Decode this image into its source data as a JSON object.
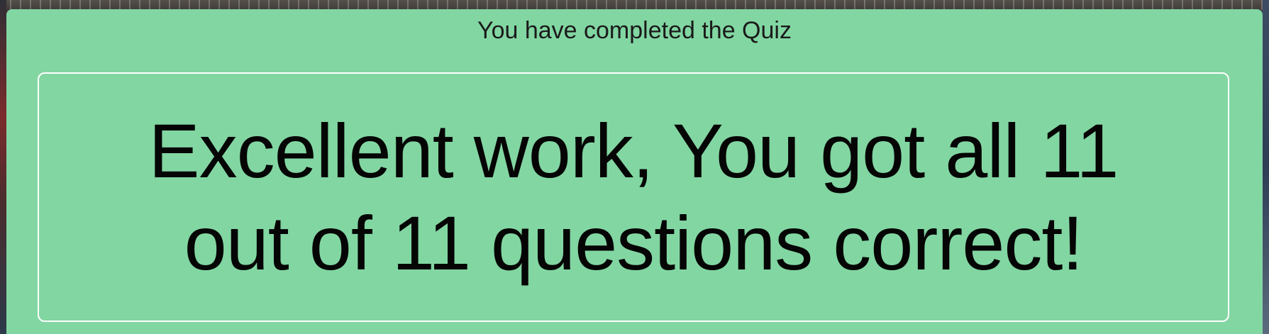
{
  "colors": {
    "panel_background": "#82d6a2",
    "result_border": "#ffffff",
    "text": "#050505"
  },
  "quiz_end": {
    "title": "You have completed the Quiz",
    "result_message": "Excellent work, You got all 11 out of 11 questions correct!"
  }
}
